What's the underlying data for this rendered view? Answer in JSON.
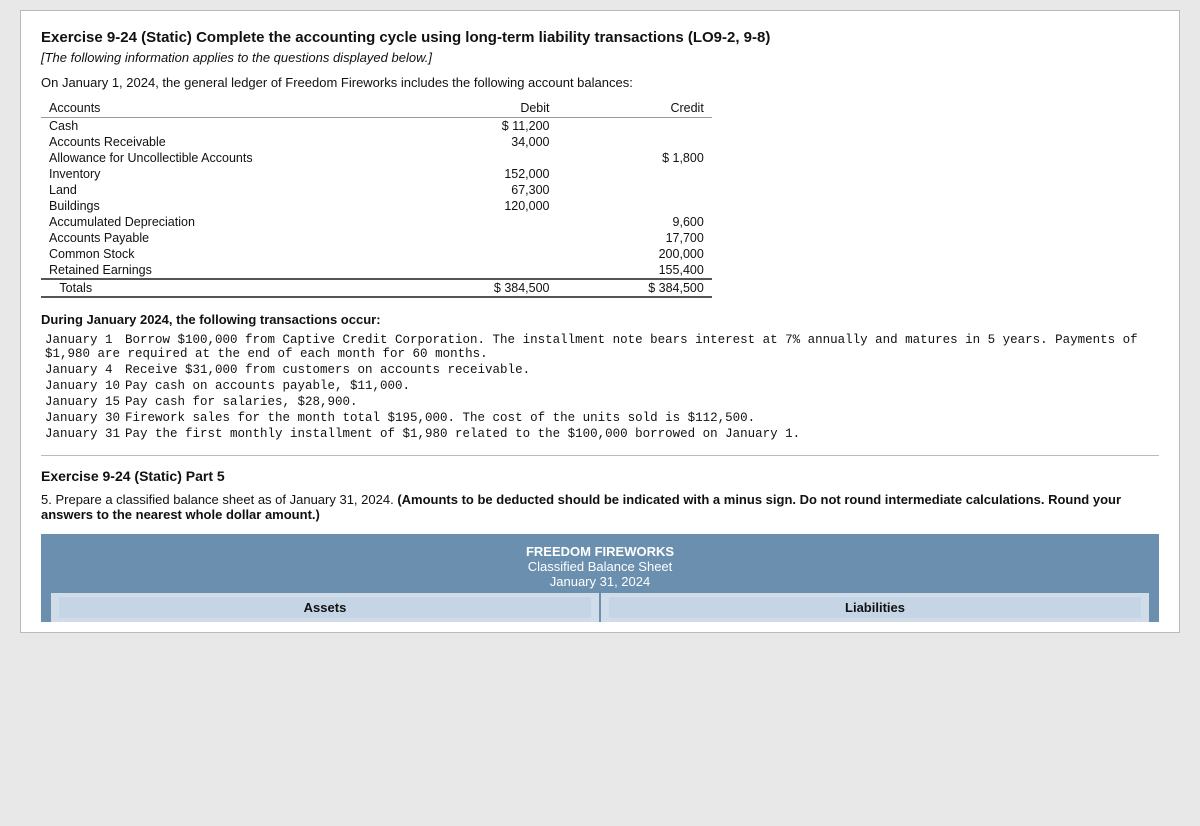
{
  "exercise": {
    "title": "Exercise 9-24 (Static) Complete the accounting cycle using long-term liability transactions (LO9-2, 9-8)",
    "subtitle": "[The following information applies to the questions displayed below.]",
    "intro": "On January 1, 2024, the general ledger of Freedom Fireworks includes the following account balances:",
    "accounts_table": {
      "headers": [
        "Accounts",
        "Debit",
        "Credit"
      ],
      "rows": [
        {
          "account": "Cash",
          "debit": "$ 11,200",
          "credit": ""
        },
        {
          "account": "Accounts Receivable",
          "debit": "34,000",
          "credit": ""
        },
        {
          "account": "Allowance for Uncollectible Accounts",
          "debit": "",
          "credit": "$ 1,800"
        },
        {
          "account": "Inventory",
          "debit": "152,000",
          "credit": ""
        },
        {
          "account": "Land",
          "debit": "67,300",
          "credit": ""
        },
        {
          "account": "Buildings",
          "debit": "120,000",
          "credit": ""
        },
        {
          "account": "Accumulated Depreciation",
          "debit": "",
          "credit": "9,600"
        },
        {
          "account": "Accounts Payable",
          "debit": "",
          "credit": "17,700"
        },
        {
          "account": "Common Stock",
          "debit": "",
          "credit": "200,000"
        },
        {
          "account": "Retained Earnings",
          "debit": "",
          "credit": "155,400"
        }
      ],
      "totals": {
        "label": "Totals",
        "debit": "$ 384,500",
        "credit": "$ 384,500"
      }
    },
    "transactions_header": "During January 2024, the following transactions occur:",
    "transactions": [
      {
        "date": "January 1",
        "text": "Borrow $100,000 from Captive Credit Corporation. The installment note bears interest at 7% annually and matures in 5 years. Payments of $1,980 are required at the end of each month for 60 months."
      },
      {
        "date": "January 4",
        "text": "Receive $31,000 from customers on accounts receivable."
      },
      {
        "date": "January 10",
        "text": "Pay cash on accounts payable, $11,000."
      },
      {
        "date": "January 15",
        "text": "Pay cash for salaries, $28,900."
      },
      {
        "date": "January 30",
        "text": "Firework sales for the month total $195,000. The cost of the units sold is $112,500."
      },
      {
        "date": "January 31",
        "text": "Pay the first monthly installment of $1,980 related to the $100,000 borrowed on January 1."
      }
    ],
    "part5": {
      "header": "Exercise 9-24 (Static) Part 5",
      "instruction_number": "5.",
      "instruction_text": "Prepare a classified balance sheet as of January 31, 2024.",
      "instruction_bold": "(Amounts to be deducted should be indicated with a minus sign. Do not round intermediate calculations. Round your answers to the nearest whole dollar amount.)",
      "balance_sheet": {
        "company": "FREEDOM FIREWORKS",
        "title": "Classified Balance Sheet",
        "date": "January 31, 2024",
        "assets_header": "Assets",
        "liabilities_header": "Liabilities"
      }
    }
  }
}
